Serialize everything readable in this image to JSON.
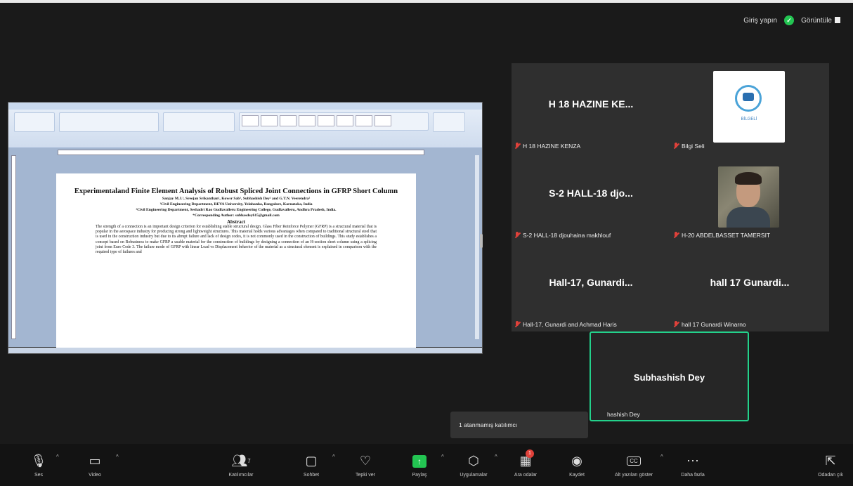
{
  "top_bar": {
    "login_label": "Giriş yapın",
    "view_label": "Görüntüle"
  },
  "shared_doc": {
    "title": "Experimentaland Finite Element Analysis of Robust Spliced Joint Connections in GFRP Short Column",
    "authors": "Sanjay M.J.¹, Sreejan Srikanthan¹, Kowsr Sab¹, Subhashish Dey² and G.T.N. Veerendra²",
    "affil1": "¹Civil Engineering Department, REVA University, Yelahanka, Bangalore, Karnataka, India",
    "affil2": "²Civil Engineering Department, Seshadri Rao Gudlavalleru Engineering College, Gudlavalleru, Andhra Pradesh, India.",
    "corresponding": "*Corresponding Author: subhasdey615@gmail.com",
    "abstract_heading": "Abstract",
    "abstract": "The strength of a connection is an important design criterion for establishing stable structural design. Glass Fiber Reinforce Polymer (GFRP) is a structural material that is popular in the aerospace industry for producing strong and lightweight structures. This material holds various advantages when compared to traditional structural steel that is used in the construction industry but due to its abrupt failure and lack of design codes, it is not commonly used in the construction of buildings. This study establishes a concept based on Robustness to make GFRP a usable material for the construction of buildings by designing a connection of an H-section short column using a splicing joint from Euro Code 3. The failure mode of GFRP with linear Load vs Displacement behavior of the material as a structural element is explained in comparison with the required type of failures and"
  },
  "participants": [
    {
      "big": "H 18 HAZINE KE...",
      "caption": "H 18 HAZINE KENZA"
    },
    {
      "big": "",
      "caption": "Bilgi Seli",
      "logo_text": "BİLGELİ"
    },
    {
      "big": "S-2 HALL-18 djo...",
      "caption": "S-2 HALL-18 djouhaina makhlouf"
    },
    {
      "big": "",
      "caption": "H-20 ABDELBASSET TAMERSIT"
    },
    {
      "big": "Hall-17, Gunardi...",
      "caption": "Hall-17, Gunardi and Achmad Haris"
    },
    {
      "big": "hall 17 Gunardi...",
      "caption": "hall 17 Gunardi Winarno"
    }
  ],
  "active_speaker": {
    "big": "Subhashish Dey",
    "caption": "hashish Dey"
  },
  "toast": "1 atanmamış katılımcı",
  "toolbar": {
    "audio": "Ses",
    "video": "Video",
    "participants": "Katılımcılar",
    "participants_count": "7",
    "chat": "Sohbet",
    "react": "Tepki ver",
    "share": "Paylaş",
    "apps": "Uygulamalar",
    "breakout": "Ara odalar",
    "breakout_badge": "1",
    "record": "Kaydet",
    "captions": "Alt yazıları göster",
    "more": "Daha fazla",
    "leave": "Odadan çık"
  },
  "colors": {
    "accent_green": "#23d18b",
    "muted_red": "#e0413a",
    "share_green": "#23c552"
  }
}
